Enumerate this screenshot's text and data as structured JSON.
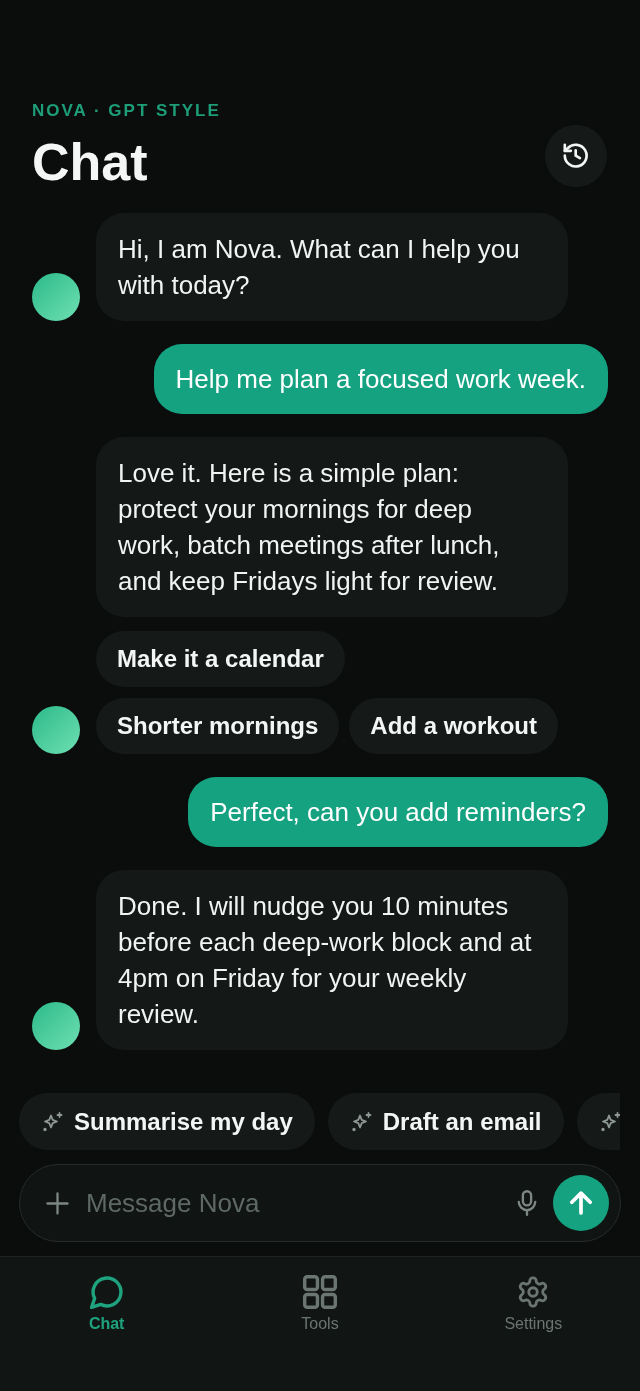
{
  "header": {
    "eyebrow": "NOVA · GPT STYLE",
    "title": "Chat"
  },
  "messages": [
    {
      "kind": "assistant",
      "text": "Hi, I am Nova. What can I help you with today?"
    },
    {
      "kind": "user",
      "text": "Help me plan a focused work week."
    },
    {
      "kind": "assistant",
      "text": "Love it. Here is a simple plan: protect your mornings for deep work, batch meetings after lunch, and keep Fridays light for review.",
      "quick_replies": [
        "Make it a calendar",
        "Shorter mornings",
        "Add a workout"
      ]
    },
    {
      "kind": "user",
      "text": "Perfect, can you add reminders?"
    },
    {
      "kind": "assistant",
      "text": "Done. I will nudge you 10 minutes before each deep-work block and at 4pm on Friday for your weekly review."
    }
  ],
  "suggestions": [
    {
      "kind": "chip",
      "label": "Summarise my day"
    },
    {
      "kind": "chip",
      "label": "Draft an email"
    },
    {
      "kind": "clipped"
    }
  ],
  "composer": {
    "placeholder": "Message Nova"
  },
  "nav": [
    {
      "label": "Chat",
      "selected": true
    },
    {
      "label": "Tools",
      "selected": false
    },
    {
      "label": "Settings",
      "selected": false
    }
  ]
}
